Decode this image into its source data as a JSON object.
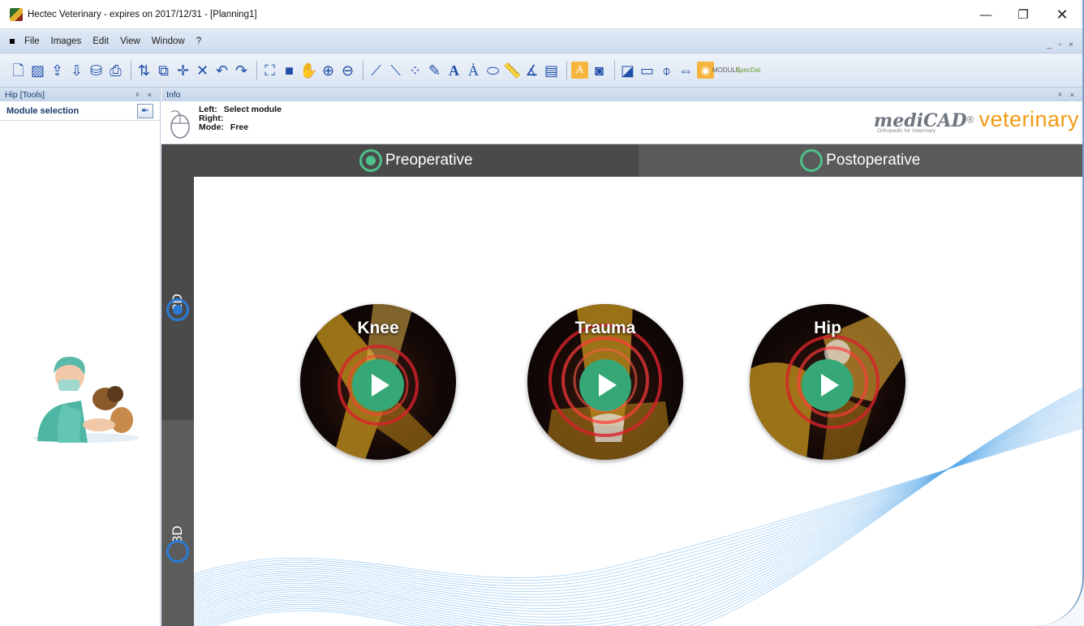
{
  "window": {
    "title": "Hectec Veterinary - expires on 2017/12/31 - [Planning1]",
    "controls": {
      "minimize": "—",
      "restore": "❐",
      "close": "✕"
    }
  },
  "menu": {
    "items": [
      "File",
      "Images",
      "Edit",
      "View",
      "Window",
      "?"
    ],
    "right_controls": "_ ▫ ×"
  },
  "toolbar": {
    "icons": [
      "new-document-icon",
      "open-image-icon",
      "import-icon",
      "export-icon",
      "pacs-icon",
      "print-icon",
      "calibrate-icon",
      "copy-icon",
      "move-icon",
      "delete-icon",
      "undo-icon",
      "redo-icon",
      "fit-icon",
      "fill-icon",
      "hand-icon",
      "zoom-in-icon",
      "zoom-out-icon",
      "line-icon",
      "angle-line-icon",
      "points-icon",
      "pen-icon",
      "text-icon",
      "text-point-icon",
      "ellipse-icon",
      "ruler-icon",
      "angle-90-icon",
      "table-icon",
      "text-style-icon",
      "display-icon",
      "screenshot-icon",
      "window-icon",
      "crosshair-icon",
      "link-icon",
      "rss-icon",
      "module-icon",
      "specialist-icon"
    ],
    "module_label": "MODULE",
    "spec_label": "SpecDat"
  },
  "left_pane": {
    "header": "Hip [Tools]",
    "header_controls": "ᵖ ×",
    "module_selection": "Module selection"
  },
  "info_pane": {
    "header": "Info",
    "header_controls": "ᵖ ×",
    "left_label": "Left:",
    "left_value": "Select module",
    "right_label": "Right:",
    "right_value": "",
    "mode_label": "Mode:",
    "mode_value": "Free"
  },
  "logo": {
    "brand": "mediCAD",
    "reg": "®",
    "product": "veterinary",
    "tagline": "Orthopedic for Veterinary"
  },
  "tabs_top": [
    {
      "label": "Preoperative",
      "selected": true
    },
    {
      "label": "Postoperative",
      "selected": false
    }
  ],
  "tabs_left": [
    {
      "label": "2D",
      "selected": true
    },
    {
      "label": "3D",
      "selected": false
    }
  ],
  "modules": [
    {
      "label": "Knee"
    },
    {
      "label": "Trauma"
    },
    {
      "label": "Hip"
    }
  ],
  "colors": {
    "accent_green": "#36a878",
    "radio_green": "#4ec08a",
    "radio_blue": "#2a7bd6",
    "logo_orange": "#f29a14",
    "toolbar_highlight": "#f6b53c"
  }
}
